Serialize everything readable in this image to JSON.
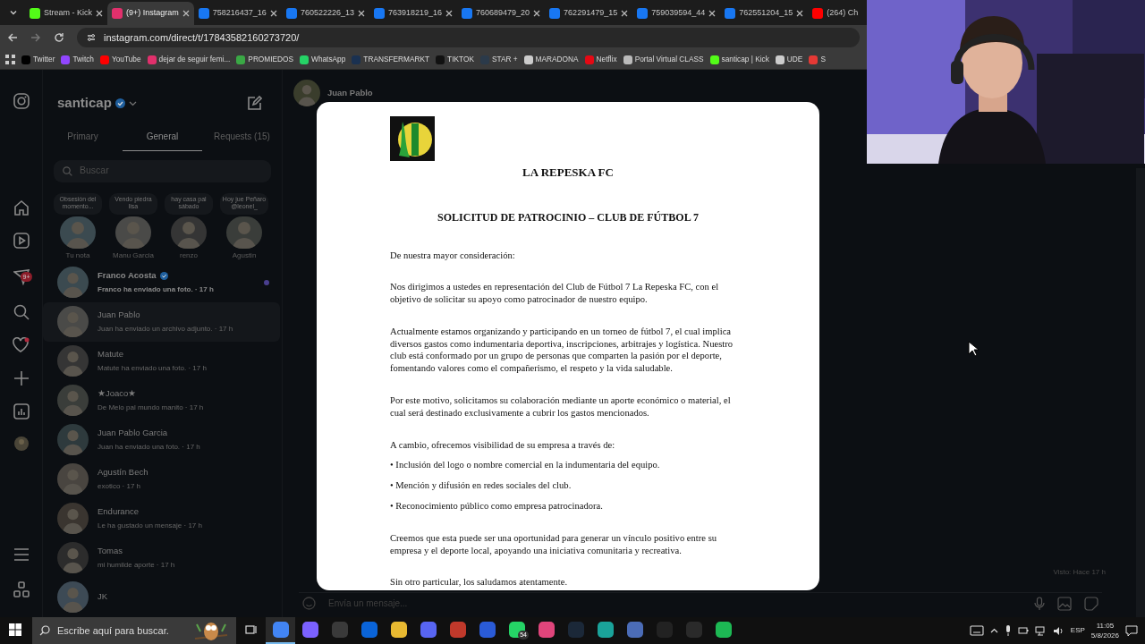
{
  "browser": {
    "tabs": [
      {
        "title": "Stream - Kick",
        "color": "#53fc18",
        "selected": false
      },
      {
        "title": "(9+) Instagram",
        "color": "#e1306c",
        "selected": true
      },
      {
        "title": "758216437_16",
        "color": "#1877f2",
        "selected": false
      },
      {
        "title": "760522226_13",
        "color": "#1877f2",
        "selected": false
      },
      {
        "title": "763918219_16",
        "color": "#1877f2",
        "selected": false
      },
      {
        "title": "760689479_20",
        "color": "#1877f2",
        "selected": false
      },
      {
        "title": "762291479_15",
        "color": "#1877f2",
        "selected": false
      },
      {
        "title": "759039594_44",
        "color": "#1877f2",
        "selected": false
      },
      {
        "title": "762551204_15",
        "color": "#1877f2",
        "selected": false
      },
      {
        "title": "(264) Ch",
        "color": "#ff0000",
        "selected": false
      }
    ],
    "address": "instagram.com/direct/t/17843582160273720/",
    "bookmarks": [
      {
        "label": "Twitter",
        "color": "#000000"
      },
      {
        "label": "Twitch",
        "color": "#9146ff"
      },
      {
        "label": "YouTube",
        "color": "#ff0000"
      },
      {
        "label": "dejar de seguir femi...",
        "color": "#e1306c"
      },
      {
        "label": "PROMIEDOS",
        "color": "#3aa845"
      },
      {
        "label": "WhatsApp",
        "color": "#25d366"
      },
      {
        "label": "TRANSFERMARKT",
        "color": "#1a3151"
      },
      {
        "label": "TIKTOK",
        "color": "#111111"
      },
      {
        "label": "STAR +",
        "color": "#2b3a4a"
      },
      {
        "label": "MARADONA",
        "color": "#cccccc"
      },
      {
        "label": "Netflix",
        "color": "#e50914"
      },
      {
        "label": "Portal Virtual CLASS",
        "color": "#bbbbbb"
      },
      {
        "label": "santicap | Kick",
        "color": "#53fc18"
      },
      {
        "label": "UDE",
        "color": "#cccccc"
      },
      {
        "label": "S",
        "color": "#e53935"
      }
    ]
  },
  "instagram": {
    "account": "santicap",
    "verified": true,
    "nav_badge": "9+",
    "inbox_tabs": [
      {
        "label": "Primary",
        "selected": false
      },
      {
        "label": "General",
        "selected": true
      },
      {
        "label": "Requests (15)",
        "selected": false
      }
    ],
    "search": {
      "placeholder": "Buscar"
    },
    "notes": [
      {
        "note": "Obsesión del momento...",
        "name": "Tu nota"
      },
      {
        "note": "Vendo piedra lisa",
        "name": "Manu Garcia"
      },
      {
        "note": "hay casa pal sábado",
        "name": "renzo"
      },
      {
        "note": "Hoy jue Peñaro @leonel_",
        "name": "Agustin"
      }
    ],
    "conversations": [
      {
        "name": "Franco Acosta",
        "preview": "Franco ha enviado una foto. · 17 h",
        "verified": true,
        "unread": true,
        "selected": false
      },
      {
        "name": "Juan Pablo",
        "preview": "Juan ha enviado un archivo adjunto. · 17 h",
        "verified": false,
        "unread": false,
        "selected": true
      },
      {
        "name": "Matute",
        "preview": "Matute ha enviado una foto. · 17 h",
        "verified": false,
        "unread": false,
        "selected": false
      },
      {
        "name": "★Joaco★",
        "preview": "De Melo pal mundo manito · 17 h",
        "verified": false,
        "unread": false,
        "selected": false
      },
      {
        "name": "Juan Pablo Garcia",
        "preview": "Juan ha enviado una foto. · 17 h",
        "verified": false,
        "unread": false,
        "selected": false
      },
      {
        "name": "Agustín Bech",
        "preview": "exotico · 17 h",
        "verified": false,
        "unread": false,
        "selected": false
      },
      {
        "name": "Endurance",
        "preview": "Le ha gustado un mensaje · 17 h",
        "verified": false,
        "unread": false,
        "selected": false
      },
      {
        "name": "Tomas",
        "preview": "mi humilde aporte · 17 h",
        "verified": false,
        "unread": false,
        "selected": false
      },
      {
        "name": "JK",
        "verified": false,
        "unread": false,
        "selected": false
      }
    ],
    "chat": {
      "name": "Juan Pablo",
      "seen": "Visto: Hace 17 h",
      "placeholder": "Envía un mensaje..."
    }
  },
  "document": {
    "title": "LA REPESKA FC",
    "subtitle": "SOLICITUD DE PATROCINIO – CLUB DE FÚTBOL 7",
    "blocks": [
      {
        "kind": "paragraph",
        "text": "De nuestra mayor consideración:"
      },
      {
        "kind": "paragraph",
        "text": "Nos dirigimos a ustedes en representación del Club de Fútbol 7 La Repeska FC, con el objetivo de solicitar su apoyo como patrocinador de nuestro equipo."
      },
      {
        "kind": "paragraph",
        "text": "Actualmente estamos organizando y participando en un torneo de fútbol 7, el cual implica diversos gastos como indumentaria deportiva, inscripciones, arbitrajes y logística. Nuestro club está conformado por un grupo de personas que comparten la pasión por el deporte, fomentando valores como el compañerismo, el respeto y la vida saludable."
      },
      {
        "kind": "paragraph",
        "text": "Por este motivo, solicitamos su colaboración mediante un aporte económico o material, el cual será destinado exclusivamente a cubrir los gastos mencionados."
      },
      {
        "kind": "paragraph",
        "text": "A cambio, ofrecemos visibilidad de su empresa a través de:"
      },
      {
        "kind": "bullet",
        "text": "• Inclusión del logo o nombre comercial en la indumentaria del equipo."
      },
      {
        "kind": "bullet",
        "text": "• Mención y difusión en redes sociales del club."
      },
      {
        "kind": "bullet",
        "text": "• Reconocimiento público como empresa patrocinadora."
      },
      {
        "kind": "paragraph",
        "text": "Creemos que esta puede ser una oportunidad para generar un vínculo positivo entre su empresa y el deporte local, apoyando una iniciativa comunitaria y recreativa."
      },
      {
        "kind": "paragraph",
        "text": "Sin otro particular, los saludamos atentamente."
      }
    ]
  },
  "taskbar": {
    "search_placeholder": "Escribe aquí para buscar.",
    "apps": [
      {
        "color": "#4285f4",
        "selected": true
      },
      {
        "color": "#7b61ff",
        "selected": false
      },
      {
        "color": "#3a3a3a",
        "selected": false
      },
      {
        "color": "#0a64d8",
        "selected": false
      },
      {
        "color": "#e8b931",
        "selected": false
      },
      {
        "color": "#5865f2",
        "selected": false
      },
      {
        "color": "#c0392b",
        "selected": false
      },
      {
        "color": "#2a5bd7",
        "selected": false
      },
      {
        "color": "#25d366",
        "selected": false,
        "badge": "54"
      },
      {
        "color": "#e0457b",
        "selected": false
      },
      {
        "color": "#1b2838",
        "selected": false
      },
      {
        "color": "#1aa39a",
        "selected": false
      },
      {
        "color": "#4b6cb7",
        "selected": false
      },
      {
        "color": "#222222",
        "selected": false
      },
      {
        "color": "#2a2a2a",
        "selected": false
      },
      {
        "color": "#1db954",
        "selected": false
      }
    ],
    "language": "ESP",
    "time": "11:05",
    "date": "5/8/2026"
  }
}
